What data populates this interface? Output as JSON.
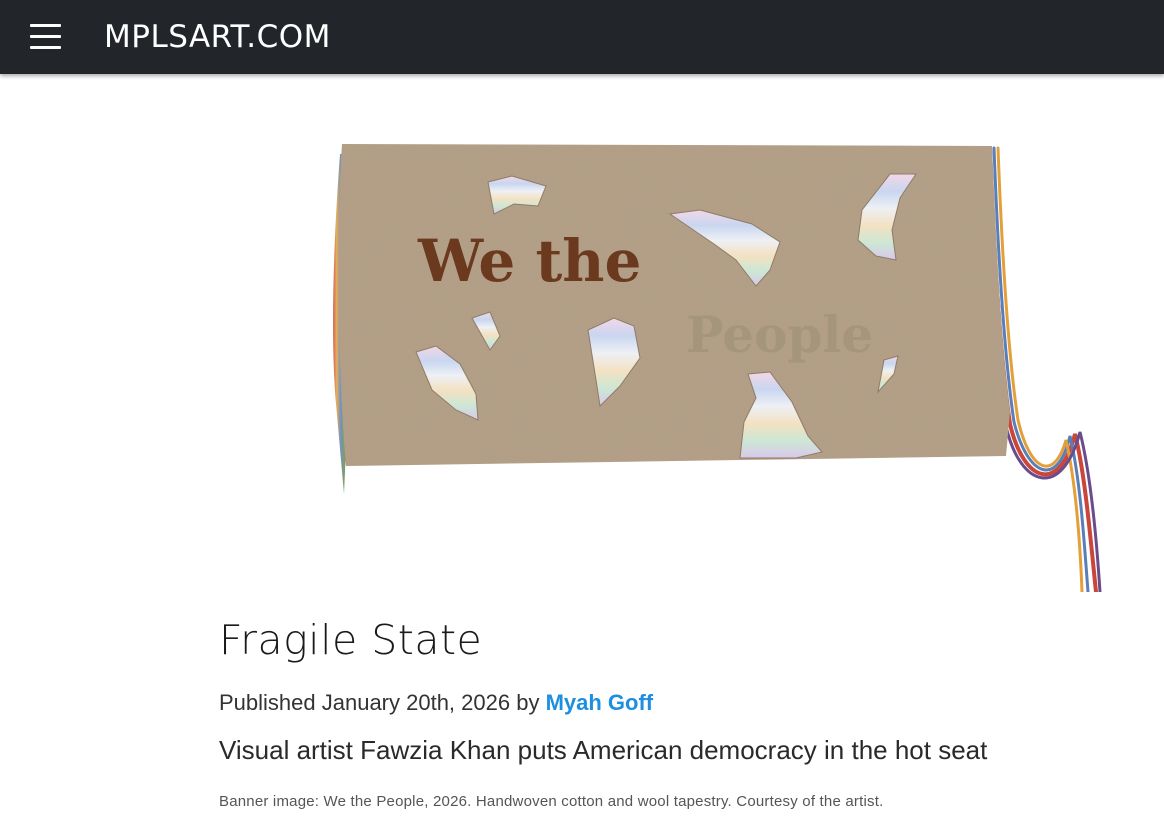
{
  "header": {
    "site_title": "MPLSART.COM",
    "menu_icon": "hamburger-menu-icon",
    "background_color": "#22262b"
  },
  "banner": {
    "image_text_1": "We the",
    "image_text_2": "People",
    "fabric_color": "#b29e85"
  },
  "article": {
    "title": "Fragile State",
    "published_prefix": "Published January 20th, 2026 by ",
    "author": "Myah Goff",
    "subtitle": "Visual artist Fawzia Khan puts American democracy in the hot seat",
    "caption": "Banner image: We the People, 2026. Handwoven cotton and wool tapestry. Courtesy of the artist.",
    "link_color": "#1e8fe0"
  }
}
